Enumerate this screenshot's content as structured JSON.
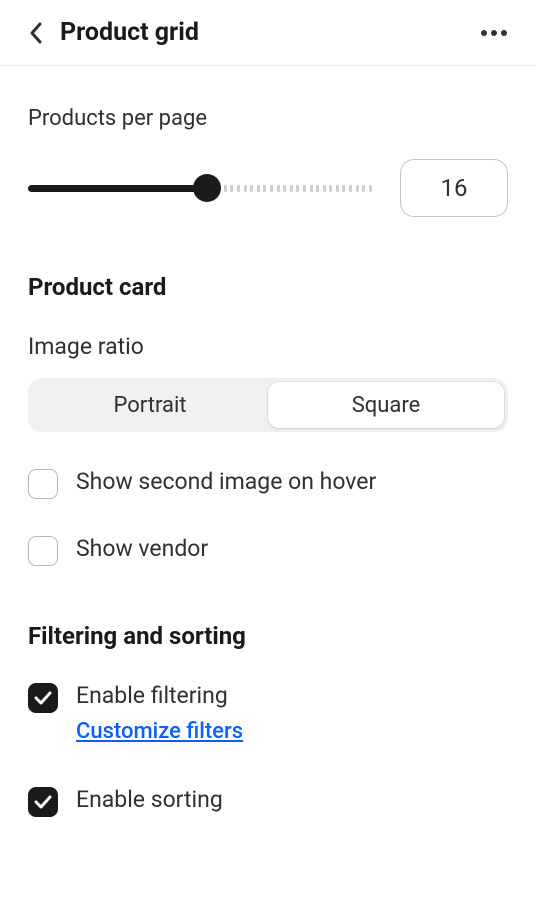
{
  "header": {
    "title": "Product grid"
  },
  "products_per_page": {
    "label": "Products per page",
    "value": "16",
    "percent": 52
  },
  "product_card": {
    "heading": "Product card",
    "image_ratio": {
      "label": "Image ratio",
      "options": [
        "Portrait",
        "Square"
      ],
      "selected": "Square"
    },
    "show_second_image": {
      "label": "Show second image on hover",
      "checked": false
    },
    "show_vendor": {
      "label": "Show vendor",
      "checked": false
    }
  },
  "filtering_sorting": {
    "heading": "Filtering and sorting",
    "enable_filtering": {
      "label": "Enable filtering",
      "checked": true,
      "link": "Customize filters"
    },
    "enable_sorting": {
      "label": "Enable sorting",
      "checked": true
    }
  }
}
